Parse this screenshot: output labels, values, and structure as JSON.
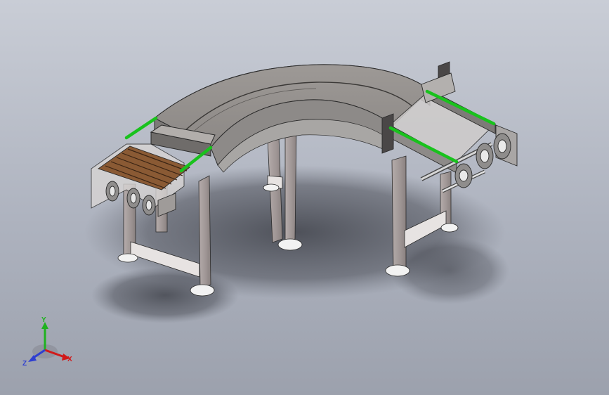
{
  "viewport": {
    "background_top": "#c9cdd6",
    "background_bottom": "#9ca1ad"
  },
  "model": {
    "frame_color": "#a59c9a",
    "belt_color": "#9b9794",
    "slat_color": "#8a5a34",
    "guide_color": "#19c21d"
  },
  "triad": {
    "x_label": "X",
    "y_label": "Y",
    "z_label": "Z",
    "x_color": "#d11a1a",
    "y_color": "#1fb21f",
    "z_color": "#2f3fd0"
  }
}
